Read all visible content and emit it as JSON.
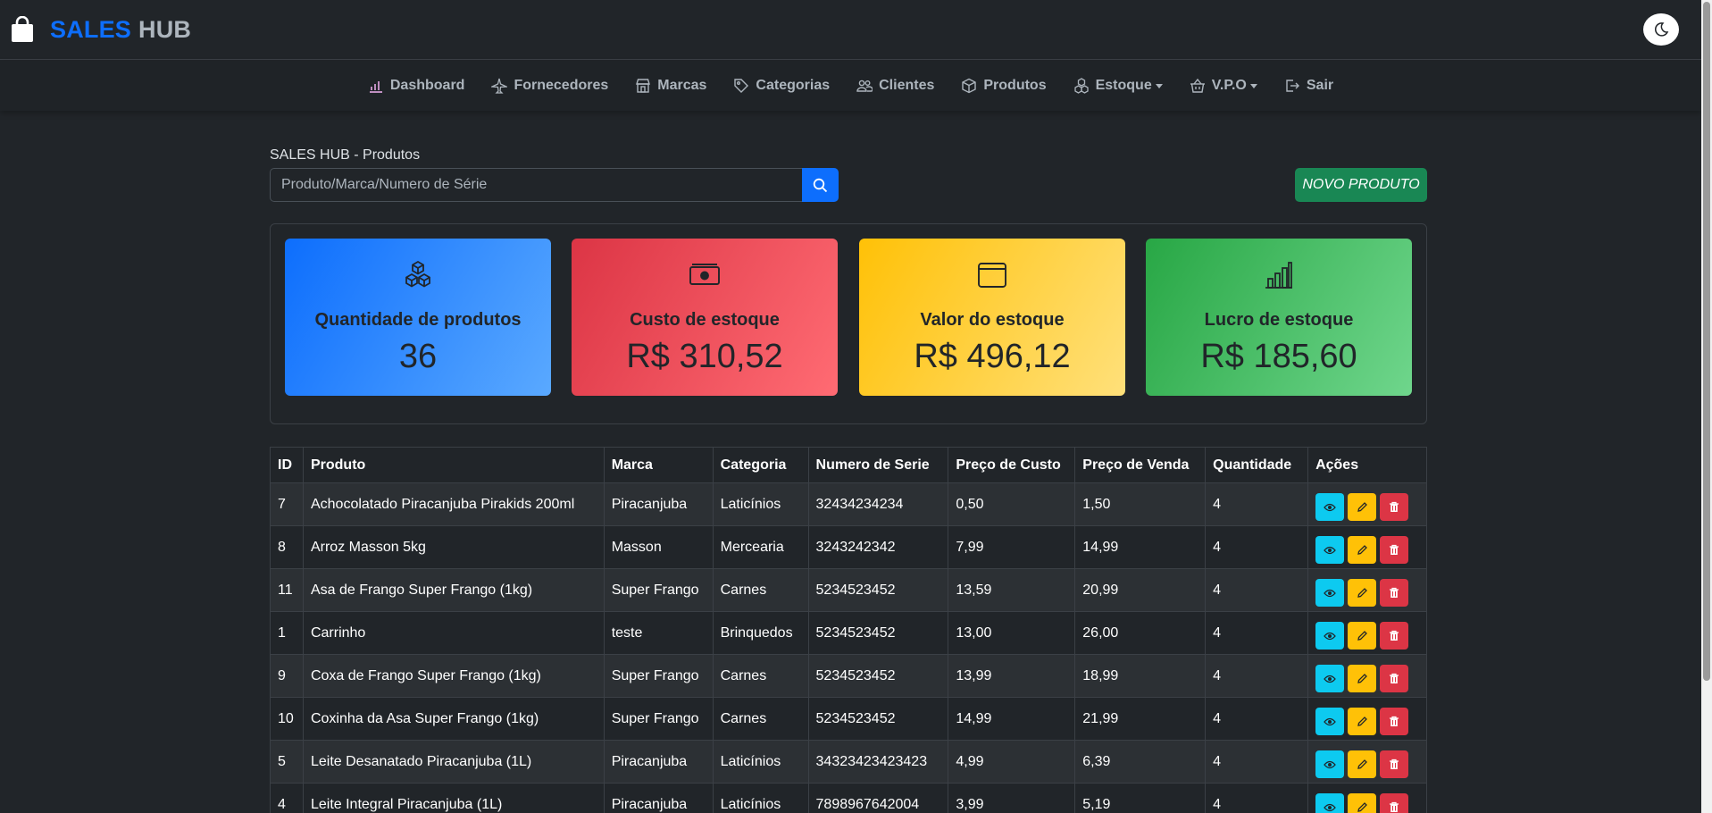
{
  "header": {
    "brand_part1": "SALES",
    "brand_part2": "HUB"
  },
  "nav": {
    "items": [
      {
        "label": "Dashboard"
      },
      {
        "label": "Fornecedores"
      },
      {
        "label": "Marcas"
      },
      {
        "label": "Categorias"
      },
      {
        "label": "Clientes"
      },
      {
        "label": "Produtos"
      },
      {
        "label": "Estoque"
      },
      {
        "label": "V.P.O"
      },
      {
        "label": "Sair"
      }
    ]
  },
  "main": {
    "page_label": "SALES HUB - Produtos",
    "search_placeholder": "Produto/Marca/Numero de Série",
    "new_button": "NOVO PRODUTO"
  },
  "cards": [
    {
      "title": "Quantidade de produtos",
      "value": "36",
      "icon": "boxes-icon",
      "color": "#0d6efd"
    },
    {
      "title": "Custo de estoque",
      "value": "R$ 310,52",
      "icon": "cash-icon",
      "color": "#dc3545"
    },
    {
      "title": "Valor do estoque",
      "value": "R$ 496,12",
      "icon": "wallet-icon",
      "color": "#ffc107"
    },
    {
      "title": "Lucro de estoque",
      "value": "R$ 185,60",
      "icon": "bar-chart-icon",
      "color": "#28a745"
    }
  ],
  "table": {
    "headers": [
      "ID",
      "Produto",
      "Marca",
      "Categoria",
      "Numero de Serie",
      "Preço de Custo",
      "Preço de Venda",
      "Quantidade",
      "Ações"
    ],
    "rows": [
      [
        "7",
        "Achocolatado Piracanjuba Pirakids 200ml",
        "Piracanjuba",
        "Laticínios",
        "32434234234",
        "0,50",
        "1,50",
        "4"
      ],
      [
        "8",
        "Arroz Masson 5kg",
        "Masson",
        "Mercearia",
        "3243242342",
        "7,99",
        "14,99",
        "4"
      ],
      [
        "11",
        "Asa de Frango Super Frango (1kg)",
        "Super Frango",
        "Carnes",
        "5234523452",
        "13,59",
        "20,99",
        "4"
      ],
      [
        "1",
        "Carrinho",
        "teste",
        "Brinquedos",
        "5234523452",
        "13,00",
        "26,00",
        "4"
      ],
      [
        "9",
        "Coxa de Frango Super Frango (1kg)",
        "Super Frango",
        "Carnes",
        "5234523452",
        "13,99",
        "18,99",
        "4"
      ],
      [
        "10",
        "Coxinha da Asa Super Frango (1kg)",
        "Super Frango",
        "Carnes",
        "5234523452",
        "14,99",
        "21,99",
        "4"
      ],
      [
        "5",
        "Leite Desanatado Piracanjuba (1L)",
        "Piracanjuba",
        "Laticínios",
        "34323423423423",
        "4,99",
        "6,39",
        "4"
      ],
      [
        "4",
        "Leite Integral Piracanjuba (1L)",
        "Piracanjuba",
        "Laticínios",
        "7898967642004",
        "3,99",
        "5,19",
        "4"
      ]
    ]
  }
}
